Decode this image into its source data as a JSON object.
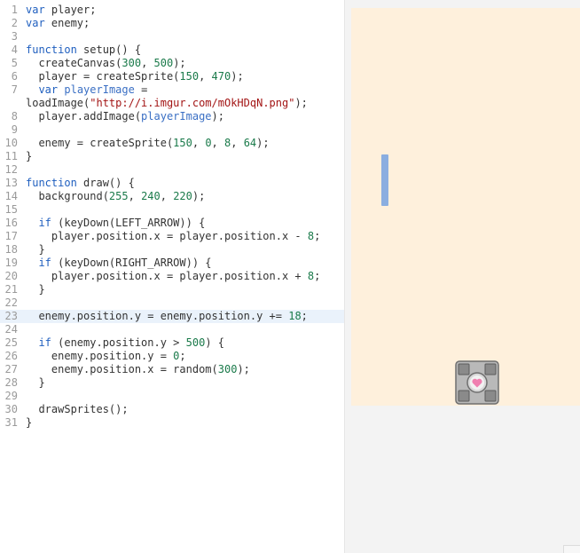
{
  "editor": {
    "highlighted_line": 23,
    "lines": [
      {
        "n": "1",
        "tokens": [
          [
            "kw",
            "var"
          ],
          [
            "plain",
            " player;"
          ]
        ]
      },
      {
        "n": "2",
        "tokens": [
          [
            "kw",
            "var"
          ],
          [
            "plain",
            " enemy;"
          ]
        ]
      },
      {
        "n": "3",
        "tokens": []
      },
      {
        "n": "4",
        "tokens": [
          [
            "kw",
            "function"
          ],
          [
            "plain",
            " setup() {"
          ]
        ]
      },
      {
        "n": "5",
        "tokens": [
          [
            "plain",
            "  createCanvas("
          ],
          [
            "num",
            "300"
          ],
          [
            "plain",
            ", "
          ],
          [
            "num",
            "500"
          ],
          [
            "plain",
            ");"
          ]
        ]
      },
      {
        "n": "6",
        "tokens": [
          [
            "plain",
            "  player = createSprite("
          ],
          [
            "num",
            "150"
          ],
          [
            "plain",
            ", "
          ],
          [
            "num",
            "470"
          ],
          [
            "plain",
            ");"
          ]
        ]
      },
      {
        "n": "7",
        "tokens": [
          [
            "plain",
            "  "
          ],
          [
            "kw",
            "var"
          ],
          [
            "plain",
            " "
          ],
          [
            "var",
            "playerImage"
          ],
          [
            "plain",
            " ="
          ]
        ]
      },
      {
        "n": "",
        "tokens": [
          [
            "plain",
            "loadImage("
          ],
          [
            "str",
            "\"http://i.imgur.com/mOkHDqN.png\""
          ],
          [
            "plain",
            ");"
          ]
        ]
      },
      {
        "n": "8",
        "tokens": [
          [
            "plain",
            "  player.addImage("
          ],
          [
            "var",
            "playerImage"
          ],
          [
            "plain",
            ");"
          ]
        ]
      },
      {
        "n": "9",
        "tokens": []
      },
      {
        "n": "10",
        "tokens": [
          [
            "plain",
            "  enemy = createSprite("
          ],
          [
            "num",
            "150"
          ],
          [
            "plain",
            ", "
          ],
          [
            "num",
            "0"
          ],
          [
            "plain",
            ", "
          ],
          [
            "num",
            "8"
          ],
          [
            "plain",
            ", "
          ],
          [
            "num",
            "64"
          ],
          [
            "plain",
            ");"
          ]
        ]
      },
      {
        "n": "11",
        "tokens": [
          [
            "plain",
            "}"
          ]
        ]
      },
      {
        "n": "12",
        "tokens": []
      },
      {
        "n": "13",
        "tokens": [
          [
            "kw",
            "function"
          ],
          [
            "plain",
            " draw() {"
          ]
        ]
      },
      {
        "n": "14",
        "tokens": [
          [
            "plain",
            "  background("
          ],
          [
            "num",
            "255"
          ],
          [
            "plain",
            ", "
          ],
          [
            "num",
            "240"
          ],
          [
            "plain",
            ", "
          ],
          [
            "num",
            "220"
          ],
          [
            "plain",
            ");"
          ]
        ]
      },
      {
        "n": "15",
        "tokens": []
      },
      {
        "n": "16",
        "tokens": [
          [
            "plain",
            "  "
          ],
          [
            "kw",
            "if"
          ],
          [
            "plain",
            " (keyDown(LEFT_ARROW)) {"
          ]
        ]
      },
      {
        "n": "17",
        "tokens": [
          [
            "plain",
            "    player.position.x = player.position.x - "
          ],
          [
            "num",
            "8"
          ],
          [
            "plain",
            ";"
          ]
        ]
      },
      {
        "n": "18",
        "tokens": [
          [
            "plain",
            "  }"
          ]
        ]
      },
      {
        "n": "19",
        "tokens": [
          [
            "plain",
            "  "
          ],
          [
            "kw",
            "if"
          ],
          [
            "plain",
            " (keyDown(RIGHT_ARROW)) {"
          ]
        ]
      },
      {
        "n": "20",
        "tokens": [
          [
            "plain",
            "    player.position.x = player.position.x + "
          ],
          [
            "num",
            "8"
          ],
          [
            "plain",
            ";"
          ]
        ]
      },
      {
        "n": "21",
        "tokens": [
          [
            "plain",
            "  }"
          ]
        ]
      },
      {
        "n": "22",
        "tokens": []
      },
      {
        "n": "23",
        "tokens": [
          [
            "plain",
            "  enemy.position.y = enemy.position.y += "
          ],
          [
            "num",
            "18"
          ],
          [
            "plain",
            ";"
          ]
        ]
      },
      {
        "n": "24",
        "tokens": []
      },
      {
        "n": "25",
        "tokens": [
          [
            "plain",
            "  "
          ],
          [
            "kw",
            "if"
          ],
          [
            "plain",
            " (enemy.position.y > "
          ],
          [
            "num",
            "500"
          ],
          [
            "plain",
            ") {"
          ]
        ]
      },
      {
        "n": "26",
        "tokens": [
          [
            "plain",
            "    enemy.position.y = "
          ],
          [
            "num",
            "0"
          ],
          [
            "plain",
            ";"
          ]
        ]
      },
      {
        "n": "27",
        "tokens": [
          [
            "plain",
            "    enemy.position.x = random("
          ],
          [
            "num",
            "300"
          ],
          [
            "plain",
            ");"
          ]
        ]
      },
      {
        "n": "28",
        "tokens": [
          [
            "plain",
            "  }"
          ]
        ]
      },
      {
        "n": "29",
        "tokens": []
      },
      {
        "n": "30",
        "tokens": [
          [
            "plain",
            "  drawSprites();"
          ]
        ]
      },
      {
        "n": "31",
        "tokens": [
          [
            "plain",
            "}"
          ]
        ]
      }
    ]
  },
  "preview": {
    "canvas_color": "#fef0dc",
    "enemy_color": "#8aaee0",
    "player_icon": "companion-cube-icon"
  }
}
